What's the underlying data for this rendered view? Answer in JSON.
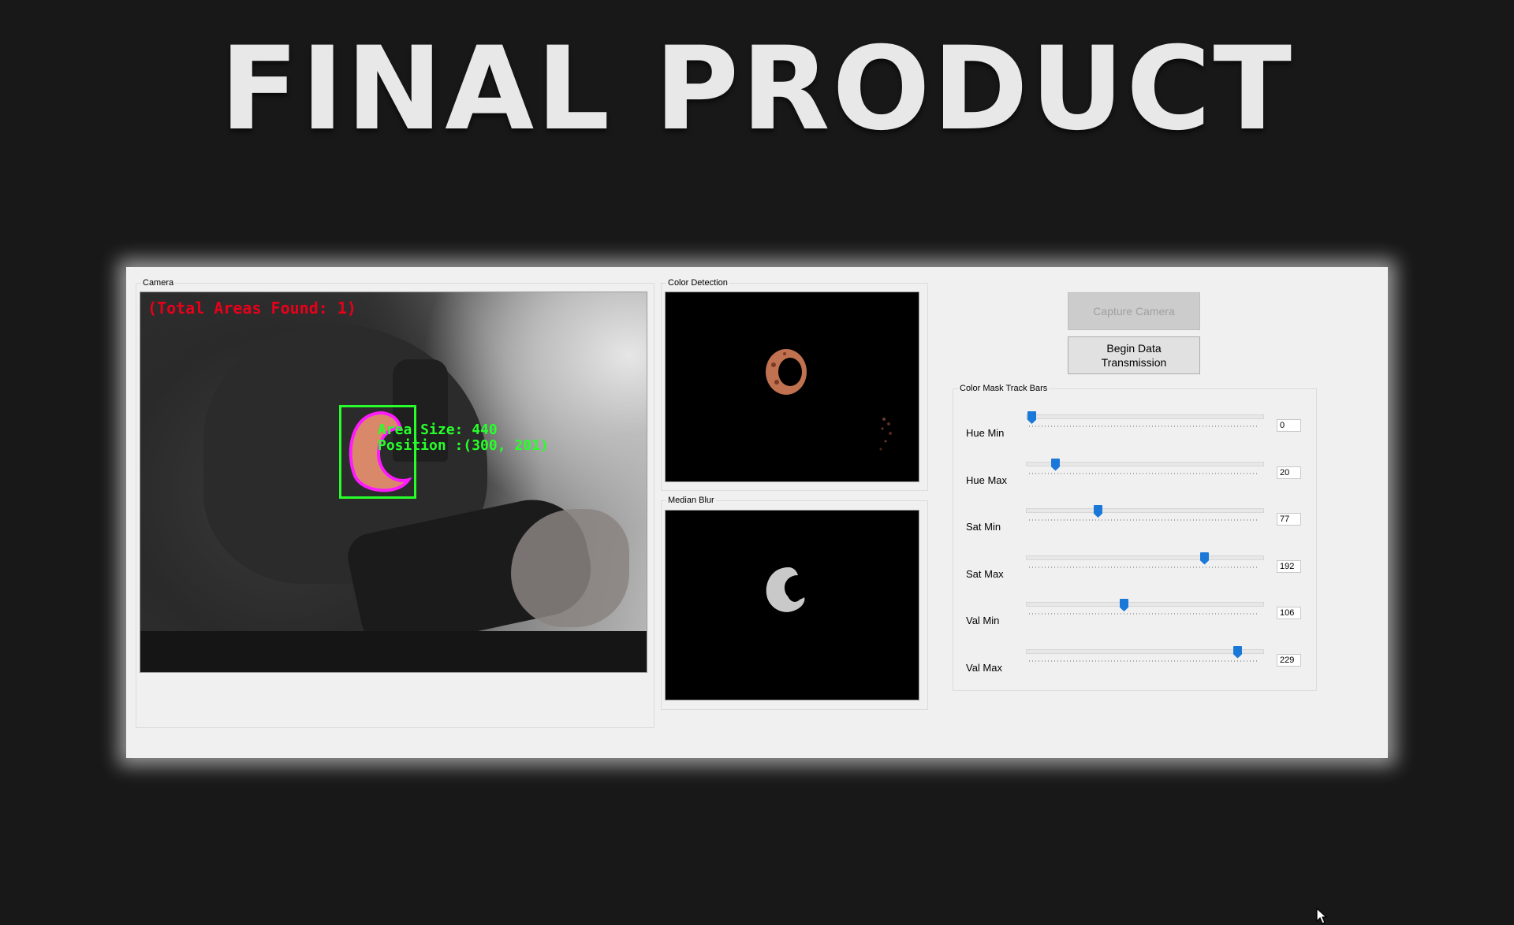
{
  "banner": {
    "title": "FINAL PRODUCT"
  },
  "window": {
    "camera": {
      "label": "Camera",
      "overlay_total": "(Total Areas Found: 1)",
      "overlay_area": "Area Size: 440",
      "overlay_position": "Position :(300, 201)"
    },
    "color_detection": {
      "label": "Color Detection"
    },
    "median_blur": {
      "label": "Median Blur"
    },
    "buttons": {
      "capture": "Capture Camera",
      "transmit": "Begin Data Transmission"
    },
    "trackbars": {
      "label": "Color Mask Track Bars",
      "items": [
        {
          "label": "Hue Min",
          "value": "0",
          "fraction": 0.02
        },
        {
          "label": "Hue Max",
          "value": "20",
          "fraction": 0.12
        },
        {
          "label": "Sat Min",
          "value": "77",
          "fraction": 0.3
        },
        {
          "label": "Sat Max",
          "value": "192",
          "fraction": 0.75
        },
        {
          "label": "Val Min",
          "value": "106",
          "fraction": 0.41
        },
        {
          "label": "Val Max",
          "value": "229",
          "fraction": 0.89
        }
      ]
    }
  },
  "colors": {
    "overlay_red": "#e8001a",
    "overlay_green": "#27ff2a",
    "contour_magenta": "#ff1aff",
    "thumb_blue": "#1a79d8"
  },
  "icons": {
    "cursor": "mouse-pointer-icon"
  }
}
